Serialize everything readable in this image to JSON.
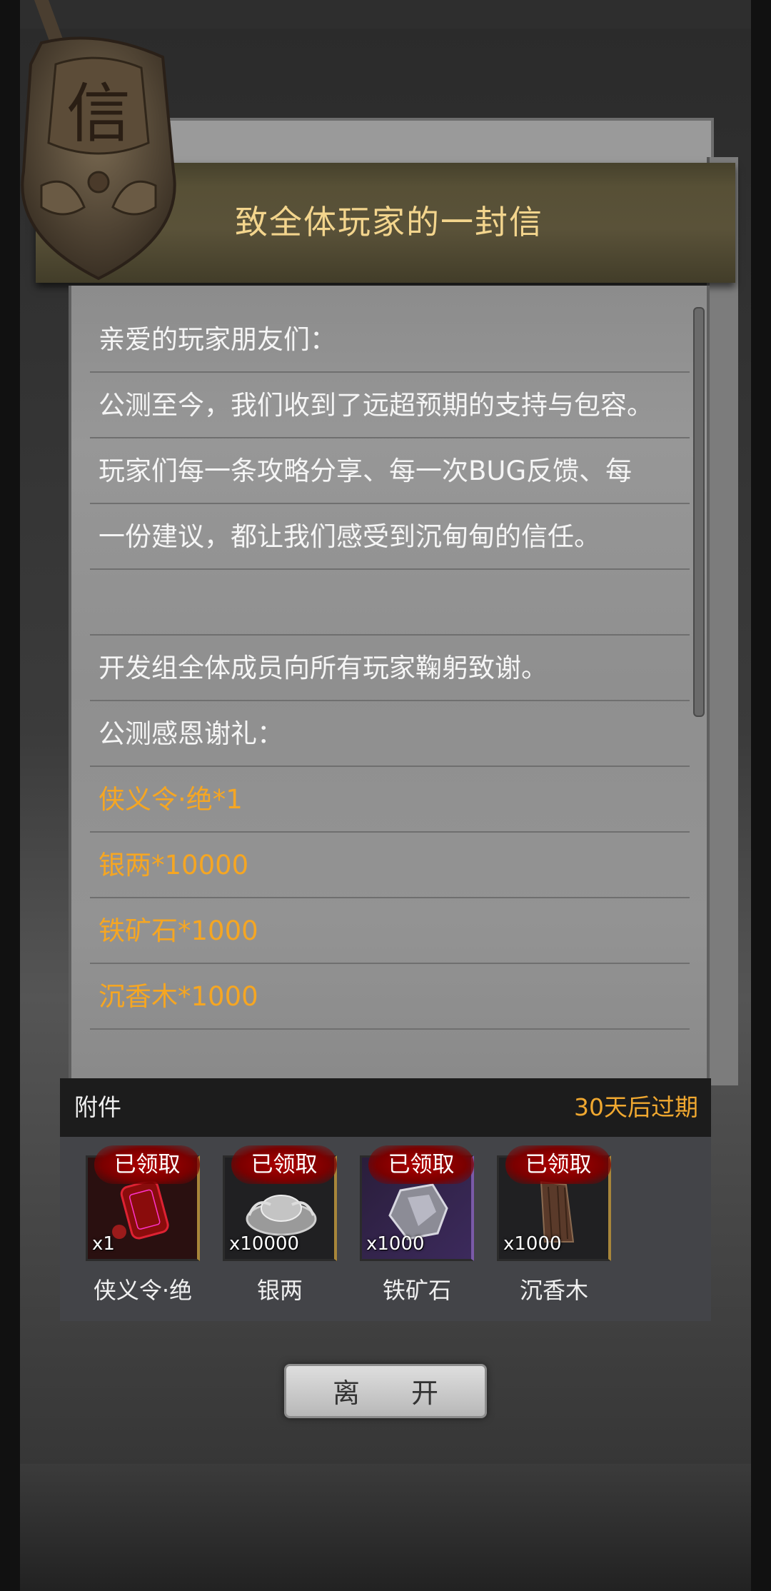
{
  "letter": {
    "badge_glyph": "信",
    "title": "致全体玩家的一封信",
    "lines": [
      "亲爱的玩家朋友们：",
      "公测至今，我们收到了远超预期的支持与包容。",
      "玩家们每一条攻略分享、每一次BUG反馈、每",
      "一份建议，都让我们感受到沉甸甸的信任。",
      "",
      "开发组全体成员向所有玩家鞠躬致谢。",
      "公测感恩谢礼："
    ],
    "rewards": [
      "侠义令·绝*1",
      "银两*10000",
      "铁矿石*1000",
      "沉香木*1000"
    ]
  },
  "attachments": {
    "label": "附件",
    "expire": "30天后过期",
    "items": [
      {
        "name": "侠义令·绝",
        "qty": "x1",
        "status": "已领取",
        "icon": "token-icon"
      },
      {
        "name": "银两",
        "qty": "x10000",
        "status": "已领取",
        "icon": "silver-ingot-icon"
      },
      {
        "name": "铁矿石",
        "qty": "x1000",
        "status": "已领取",
        "icon": "iron-ore-icon"
      },
      {
        "name": "沉香木",
        "qty": "x1000",
        "status": "已领取",
        "icon": "agarwood-icon"
      }
    ]
  },
  "footer": {
    "leave_label": "离 开"
  },
  "colors": {
    "title": "#f3d58d",
    "reward": "#f5a623",
    "expire": "#f0a830"
  }
}
